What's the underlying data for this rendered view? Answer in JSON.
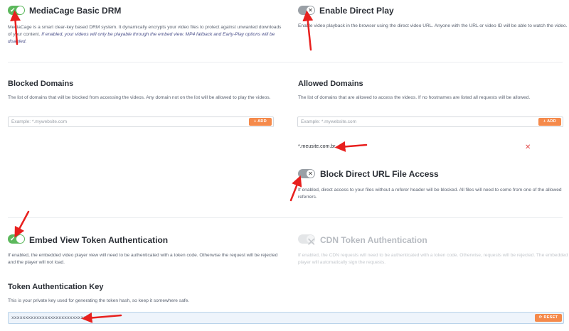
{
  "drm": {
    "title": "MediaCage Basic DRM",
    "desc_line1": "MediaCage is a smart clear-key based DRM system. It dynamically encrypts your video files to protect against unwanted downloads",
    "desc_line2_plain": "of your content. ",
    "desc_line2_italic": "If enabled, your videos will only be playable through the embed view. MP4 fallback and Early-Play options will be",
    "desc_line3_italic": "disabled.",
    "enabled": true
  },
  "direct_play": {
    "title": "Enable Direct Play",
    "desc": "Enable video playback in the browser using the direct video URL. Anyone with the URL or video ID will be able to watch the video.",
    "enabled": false
  },
  "blocked_domains": {
    "title": "Blocked Domains",
    "desc": "The list of domains that will be blocked from accessing the videos. Any domain not on the list will be allowed to play the videos.",
    "placeholder": "Example: *.mywebsite.com",
    "add_label": "+ ADD"
  },
  "allowed_domains": {
    "title": "Allowed Domains",
    "desc": "The list of domains that are allowed to access the videos. If no hostnames are listed all requests will be allowed.",
    "placeholder": "Example: *.mywebsite.com",
    "add_label": "+ ADD",
    "items": [
      "*.meusite.com.br"
    ]
  },
  "block_direct_url": {
    "title": "Block Direct URL File Access",
    "desc_line1": "If enabled, direct access to your files without a referer header will be blocked. All files will need to come from one of the allowed",
    "desc_line2": "referrers.",
    "enabled": false
  },
  "embed_token": {
    "title": "Embed View Token Authentication",
    "desc_line1": "If enabled, the embedded video player view will need to be authenticated with a token code. Otherwise the request will be rejected",
    "desc_line2": "and the player will not load.",
    "enabled": true
  },
  "cdn_token": {
    "title": "CDN Token Authentication",
    "desc_line1": "If enabled, the CDN requests will need to be authenticated with a token code. Otherwise, requests will be rejected. The embedded",
    "desc_line2": "player will automatically sign the requests.",
    "enabled": false,
    "disabled": true
  },
  "token_key": {
    "title": "Token Authentication Key",
    "desc": "This is your private key used for generating the token hash, so keep it somewhere safe.",
    "value": "xxxxxxxxxxxxxxxxxxxxxxxxxxx",
    "reset_label": "⟳ RESET"
  },
  "glyphs": {
    "check": "✔",
    "cross": "✕",
    "remove": "✕"
  },
  "colors": {
    "toggle_on": "#5cb85c",
    "toggle_off": "#9aa0a6",
    "accent_orange": "#f58a4b",
    "remove_red": "#e24b4b",
    "annotation_arrow": "#e8201e"
  }
}
